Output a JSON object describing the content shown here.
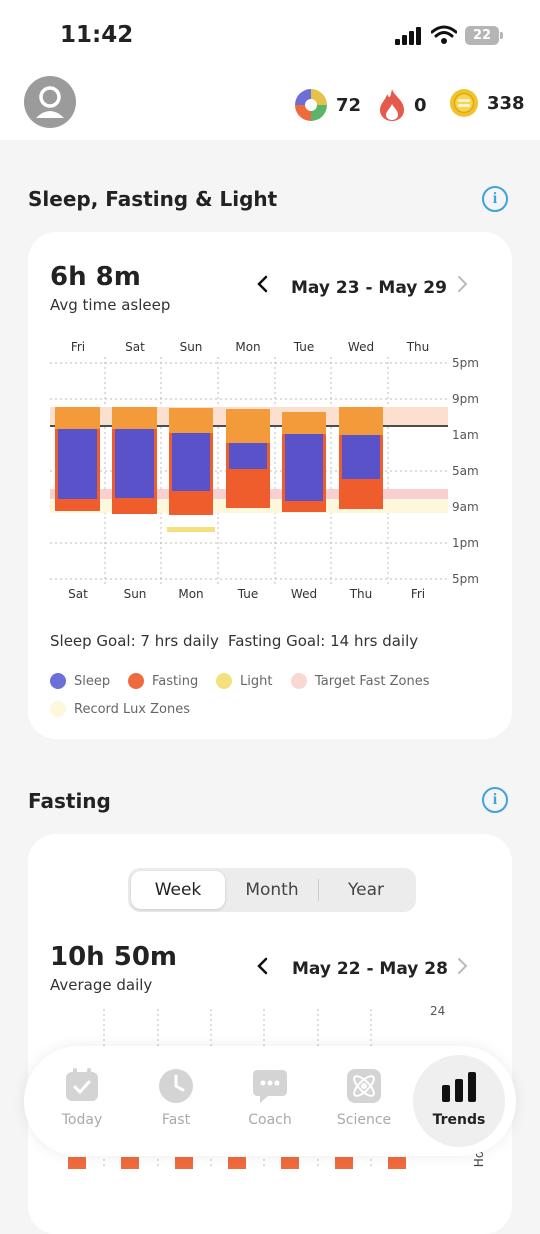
{
  "status_bar": {
    "time": "11:42",
    "battery": "22"
  },
  "header": {
    "stats": [
      {
        "icon": "balance-wheel-icon",
        "value": "72"
      },
      {
        "icon": "flame-icon",
        "value": "0"
      },
      {
        "icon": "coin-icon",
        "value": "338"
      }
    ]
  },
  "sleep_section": {
    "title": "Sleep, Fasting & Light",
    "avg_value": "6h 8m",
    "avg_label": "Avg time asleep",
    "date_range": "May 23 - May 29",
    "top_days": [
      "Fri",
      "Sat",
      "Sun",
      "Mon",
      "Tue",
      "Wed",
      "Thu"
    ],
    "bottom_days": [
      "Sat",
      "Sun",
      "Mon",
      "Tue",
      "Wed",
      "Thu",
      "Fri"
    ],
    "time_labels": [
      "5pm",
      "9pm",
      "1am",
      "5am",
      "9am",
      "1pm",
      "5pm"
    ],
    "sleep_goal": "Sleep Goal: 7 hrs daily",
    "fasting_goal": "Fasting Goal: 14 hrs daily",
    "legend": [
      {
        "label": "Sleep",
        "color": "#6b70d8"
      },
      {
        "label": "Fasting",
        "color": "#ef6a3d"
      },
      {
        "label": "Light",
        "color": "#f3e07e"
      },
      {
        "label": "Target Fast Zones",
        "color": "#f9d8d4"
      },
      {
        "label": "Record Lux Zones",
        "color": "#fdf8dc"
      }
    ]
  },
  "fasting_section": {
    "title": "Fasting",
    "tabs": [
      "Week",
      "Month",
      "Year"
    ],
    "active_tab": "Week",
    "avg_value": "10h 50m",
    "avg_label": "Average daily",
    "date_range": "May 22 - May 28",
    "axis_top": "24",
    "axis_side": "Ho"
  },
  "nav": [
    {
      "label": "Today",
      "icon": "calendar-check-icon"
    },
    {
      "label": "Fast",
      "icon": "clock-icon"
    },
    {
      "label": "Coach",
      "icon": "chat-bubble-icon"
    },
    {
      "label": "Science",
      "icon": "atom-icon"
    },
    {
      "label": "Trends",
      "icon": "bar-chart-icon"
    }
  ],
  "colors": {
    "accent": "#3ba4d8",
    "sleep": "#5a52c8",
    "fasting": "#ef6a3d",
    "fasting_top": "#f39a3a",
    "light": "#f3e07e"
  }
}
